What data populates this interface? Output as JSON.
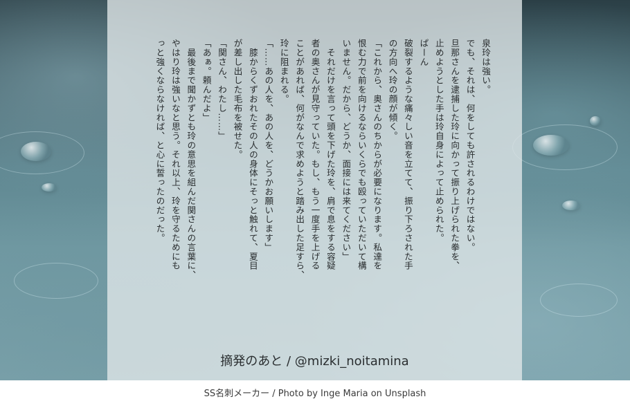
{
  "background": {
    "accent": "#6f98a1",
    "panel": "#e1e8e9",
    "icon": "rain-water-photo"
  },
  "story": {
    "lines": [
      "泉玲は強い。",
      "でも、それは、何をしても許されるわけではない。",
      "旦那さんを逮捕した玲に向かって振り上げられた拳を、",
      "止めようとした手は玲自身によって止められた。",
      "ぱーん",
      "破裂するような痛々しい音を立てて、振り下ろされた手",
      "の方向へ玲の顔が傾く。",
      "「これから、奥さんのちからが必要になります。私達を",
      "恨む力で前を向けるならいくらでも殴っていただいて構",
      "いません。だから、どうか、面接には来てください」",
      "　それだけを言って頭を下げた玲を、肩で息をする容疑",
      "者の奥さんが見守っていた。もし、もう一度手を上げる",
      "ことがあれば、何がなんで求めようと踏み出した足すら、",
      "玲に阻まれる。",
      "「……あの人を、あの人を、どうかお願いします」",
      "　膝からくずおれたその人の身体にそっと触れて、夏目",
      "が差し出した毛布を被せた。",
      "「関さん、わたし……」",
      "「あぁ。頼んだよ」",
      "　最後まで聞かずとも玲の意思を組んだ関さんの言葉に、",
      "やはり玲は強いなと思う。それ以上、玲を守るためにも",
      "っと強くならなければ、と心に誓ったのだった。"
    ]
  },
  "signature": "摘発のあと / @mizki_noitamina",
  "caption": "SS名刺メーカー / Photo by Inge Maria on Unsplash"
}
